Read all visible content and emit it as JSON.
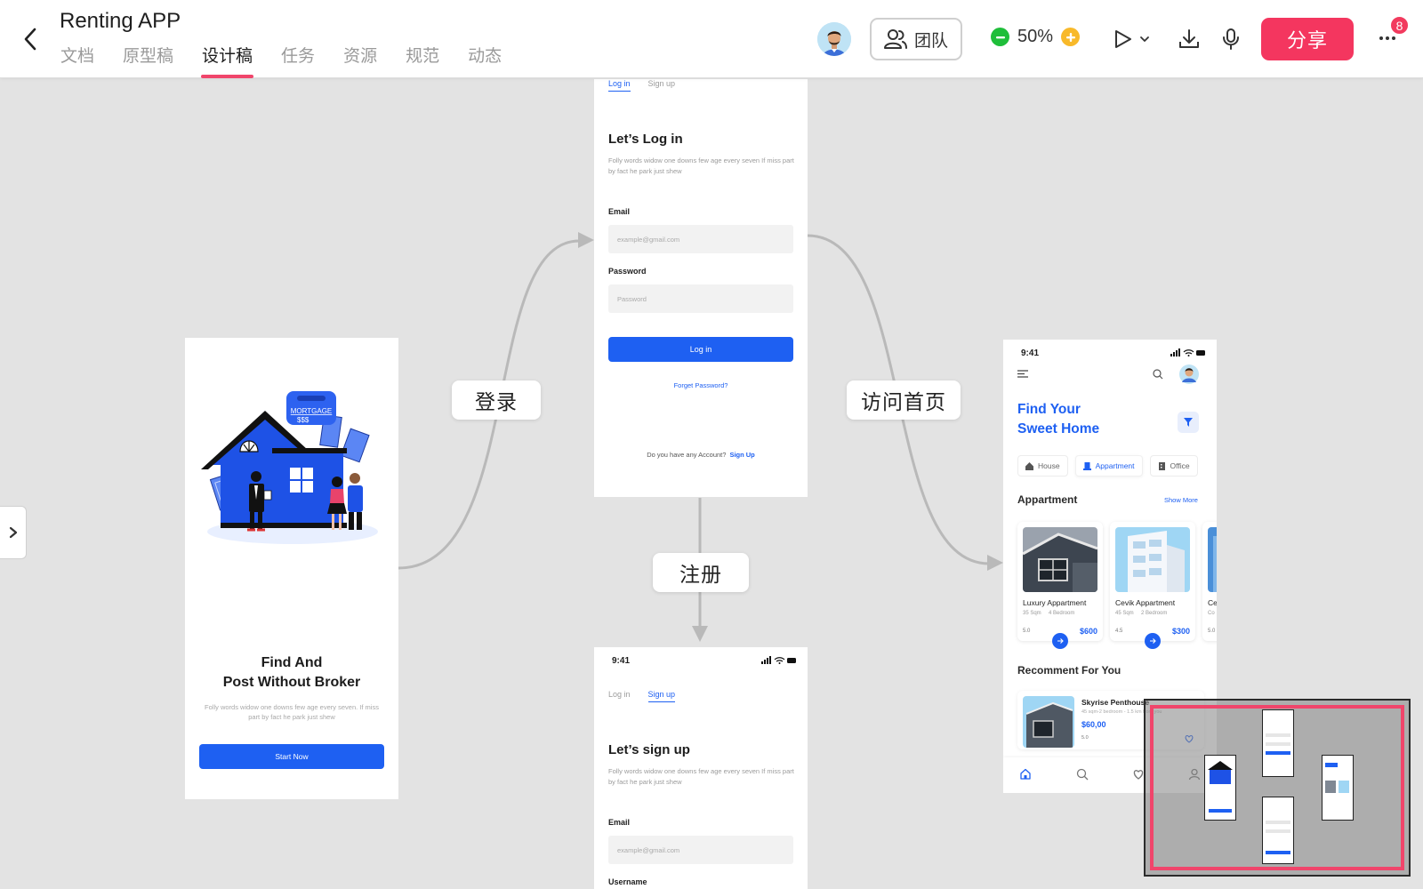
{
  "header": {
    "title": "Renting APP",
    "tabs": [
      {
        "label": "文档"
      },
      {
        "label": "原型稿"
      },
      {
        "label": "设计稿",
        "active": true
      },
      {
        "label": "任务"
      },
      {
        "label": "资源"
      },
      {
        "label": "规范"
      },
      {
        "label": "动态"
      }
    ],
    "team_label": "团队",
    "zoom": "50%",
    "share_label": "分享",
    "notification_count": "8"
  },
  "colors": {
    "accent": "#f4365f",
    "tab_indicator": "#f0456b",
    "primary_blue": "#1e60f2",
    "zoom_minus": "#1fbe3a",
    "zoom_plus": "#f8b92a"
  },
  "icons": {
    "back": "chevron-left-icon",
    "team": "users-icon",
    "play": "play-icon",
    "download": "download-icon",
    "mic": "microphone-icon",
    "more": "more-dots-icon",
    "sidebar": "chevron-right-icon"
  },
  "flow_labels": {
    "login": "登录",
    "signup": "注册",
    "home": "访问首页"
  },
  "onboarding": {
    "sign_text": "MORTGAGE",
    "sign_sub": "$$$",
    "title_line1": "Find And",
    "title_line2": "Post Without Broker",
    "subtitle": "Folly words widow one downs few age every seven. If miss part by fact he park just shew",
    "button": "Start Now"
  },
  "login": {
    "tab_login": "Log in",
    "tab_signup": "Sign up",
    "heading": "Let’s Log in",
    "desc": "Folly words widow one downs few age every seven If miss part by fact he park just shew",
    "email_label": "Email",
    "email_placeholder": "example@gmail.com",
    "password_label": "Password",
    "password_placeholder": "Password",
    "button": "Log in",
    "forgot": "Forget Password?",
    "no_account": "Do you have any Account?",
    "signup_link": "Sign Up"
  },
  "signup": {
    "time": "9:41",
    "tab_login": "Log in",
    "tab_signup": "Sign up",
    "heading": "Let’s sign up",
    "desc": "Folly words widow one downs few age every seven If miss part by fact he park just shew",
    "email_label": "Email",
    "email_placeholder": "example@gmail.com",
    "username_label": "Username"
  },
  "home": {
    "time": "9:41",
    "title_line1": "Find Your",
    "title_line2": "Sweet Home",
    "chips": [
      "House",
      "Appartment",
      "Office"
    ],
    "section": "Appartment",
    "show_more": "Show More",
    "cards": [
      {
        "name": "Luxury Appartment",
        "size": "35 Sqm",
        "rooms": "4 Bedroom",
        "rating": "5.0",
        "price": "$600"
      },
      {
        "name": "Cevik Appartment",
        "size": "45 Sqm",
        "rooms": "2 Bedroom",
        "rating": "4.5",
        "price": "$300"
      },
      {
        "name": "Ce",
        "size": "Co",
        "rooms": "",
        "rating": "5.0",
        "price": ""
      }
    ],
    "recommend_title": "Recomment For You",
    "recommend": {
      "name": "Skyrise Penthouse",
      "meta": "45 sqm-2 bedroom - 1.5 km from you",
      "price": "$60,00",
      "rating": "5.0"
    }
  }
}
